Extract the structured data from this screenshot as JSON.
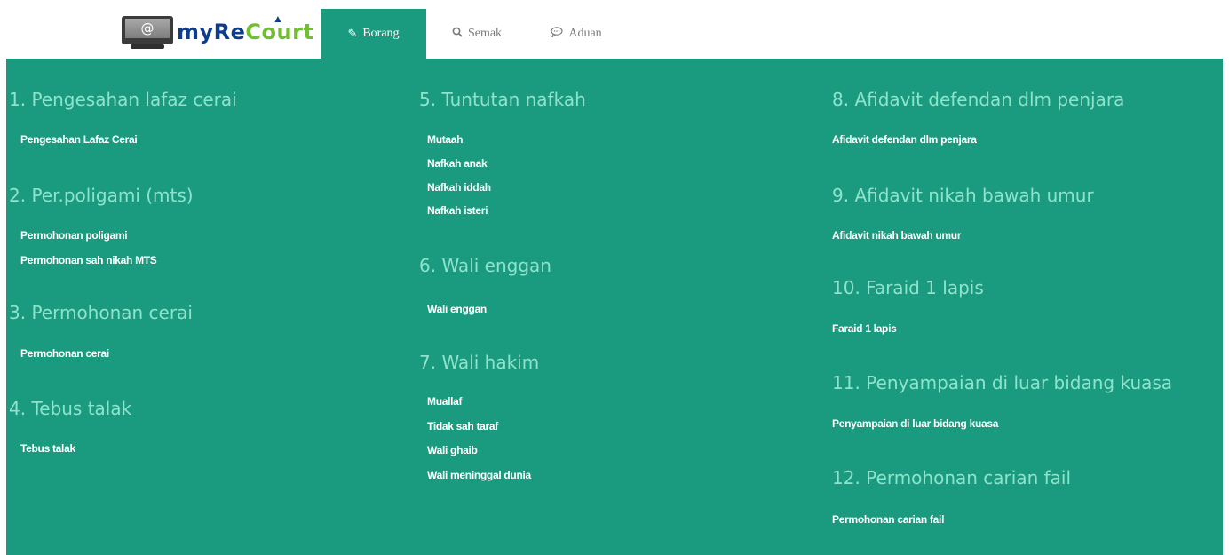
{
  "logo": {
    "monitor_text": "@",
    "brand_part1": "myRe",
    "brand_part2": "Court"
  },
  "tabs": [
    {
      "label": "Borang",
      "icon": "pencil-icon",
      "active": true
    },
    {
      "label": "Semak",
      "icon": "search-icon",
      "active": false
    },
    {
      "label": "Aduan",
      "icon": "speech-bubble-icon",
      "active": false
    }
  ],
  "colors": {
    "panel": "#1a9a7e",
    "heading": "#8fe3cc",
    "link": "#ffffff",
    "tab_inactive": "#7a7a7a"
  },
  "sections": [
    {
      "title": "1. Pengesahan lafaz cerai",
      "links": [
        "Pengesahan Lafaz Cerai"
      ]
    },
    {
      "title": "2. Per.poligami (mts)",
      "links": [
        "Permohonan poligami",
        "Permohonan sah nikah MTS"
      ]
    },
    {
      "title": "3. Permohonan cerai",
      "links": [
        "Permohonan cerai"
      ]
    },
    {
      "title": "4. Tebus talak",
      "links": [
        "Tebus talak"
      ]
    },
    {
      "title": "5. Tuntutan nafkah",
      "links": [
        "Mutaah",
        "Nafkah anak",
        "Nafkah iddah",
        "Nafkah isteri"
      ]
    },
    {
      "title": "6. Wali enggan",
      "links": [
        "Wali enggan"
      ]
    },
    {
      "title": "7. Wali hakim",
      "links": [
        "Muallaf",
        "Tidak sah taraf",
        "Wali ghaib",
        "Wali meninggal dunia"
      ]
    },
    {
      "title": "8. Afidavit defendan dlm penjara",
      "links": [
        "Afidavit defendan dlm penjara"
      ]
    },
    {
      "title": "9. Afidavit nikah bawah umur",
      "links": [
        "Afidavit nikah bawah umur"
      ]
    },
    {
      "title": "10. Faraid 1 lapis",
      "links": [
        "Faraid 1 lapis"
      ]
    },
    {
      "title": "11. Penyampaian di luar bidang kuasa",
      "links": [
        "Penyampaian di luar bidang kuasa"
      ]
    },
    {
      "title": "12. Permohonan carian fail",
      "links": [
        "Permohonan carian fail"
      ]
    }
  ]
}
